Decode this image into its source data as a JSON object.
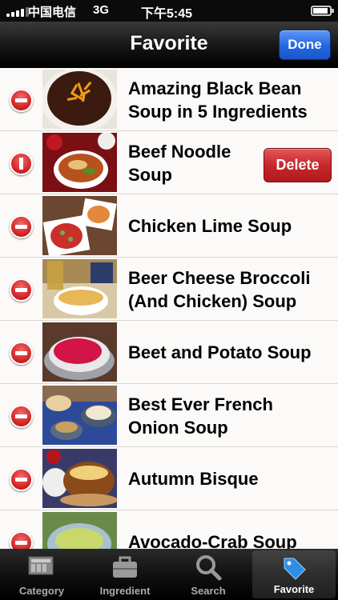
{
  "status_bar": {
    "carrier": "中国电信",
    "network": "3G",
    "time": "下午5:45"
  },
  "nav": {
    "title": "Favorite",
    "done_label": "Done"
  },
  "recipes": [
    {
      "title": "Amazing Black Bean Soup in 5 Ingredients",
      "thumb": "black-bean-soup-photo"
    },
    {
      "title": "Beef Noodle Soup",
      "thumb": "beef-noodle-soup-photo",
      "delete_label": "Delete"
    },
    {
      "title": "Chicken Lime Soup",
      "thumb": "chicken-lime-soup-photo"
    },
    {
      "title": "Beer Cheese Broccoli (And Chicken) Soup",
      "thumb": "beer-cheese-soup-photo"
    },
    {
      "title": "Beet and Potato Soup",
      "thumb": "beet-potato-soup-photo"
    },
    {
      "title": "Best Ever French Onion Soup",
      "thumb": "french-onion-soup-photo"
    },
    {
      "title": "Autumn Bisque",
      "thumb": "autumn-bisque-photo"
    },
    {
      "title": "Avocado-Crab Soup",
      "thumb": "avocado-crab-soup-photo"
    }
  ],
  "tabs": [
    {
      "label": "Category",
      "icon": "category-icon"
    },
    {
      "label": "Ingredient",
      "icon": "ingredient-icon"
    },
    {
      "label": "Search",
      "icon": "search-icon"
    },
    {
      "label": "Favorite",
      "icon": "favorite-tag-icon",
      "active": true
    }
  ]
}
